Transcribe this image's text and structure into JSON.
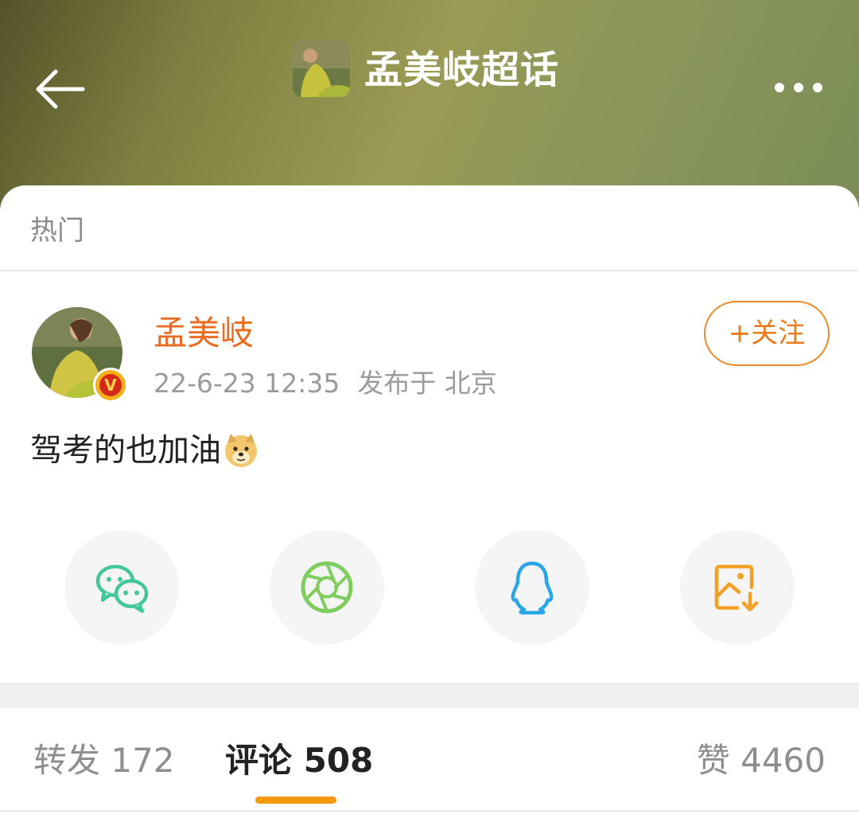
{
  "header": {
    "title": "孟美岐超话",
    "back_icon": "arrow-left-icon",
    "more_icon": "more-dots-icon"
  },
  "feed": {
    "section_label": "热门"
  },
  "post": {
    "author": "孟美岐",
    "verified_badge": "V",
    "timestamp": "22-6-23 12:35",
    "location": "发布于 北京",
    "follow_label": "+关注",
    "text": "驾考的也加油",
    "emoji_icon": "doge-emoji-icon"
  },
  "share_options": [
    {
      "icon": "wechat-icon",
      "color": "#43c79a"
    },
    {
      "icon": "moments-aperture-icon",
      "color": "#7fcd5e"
    },
    {
      "icon": "qq-penguin-icon",
      "color": "#2aa6e8"
    },
    {
      "icon": "save-image-icon",
      "color": "#f3a126"
    }
  ],
  "tabs": {
    "repost": "转发 172",
    "comment": "评论 508",
    "like": "赞 4460"
  },
  "colors": {
    "accent_orange": "#eb6b1e",
    "tab_indicator": "#f39a0f"
  }
}
